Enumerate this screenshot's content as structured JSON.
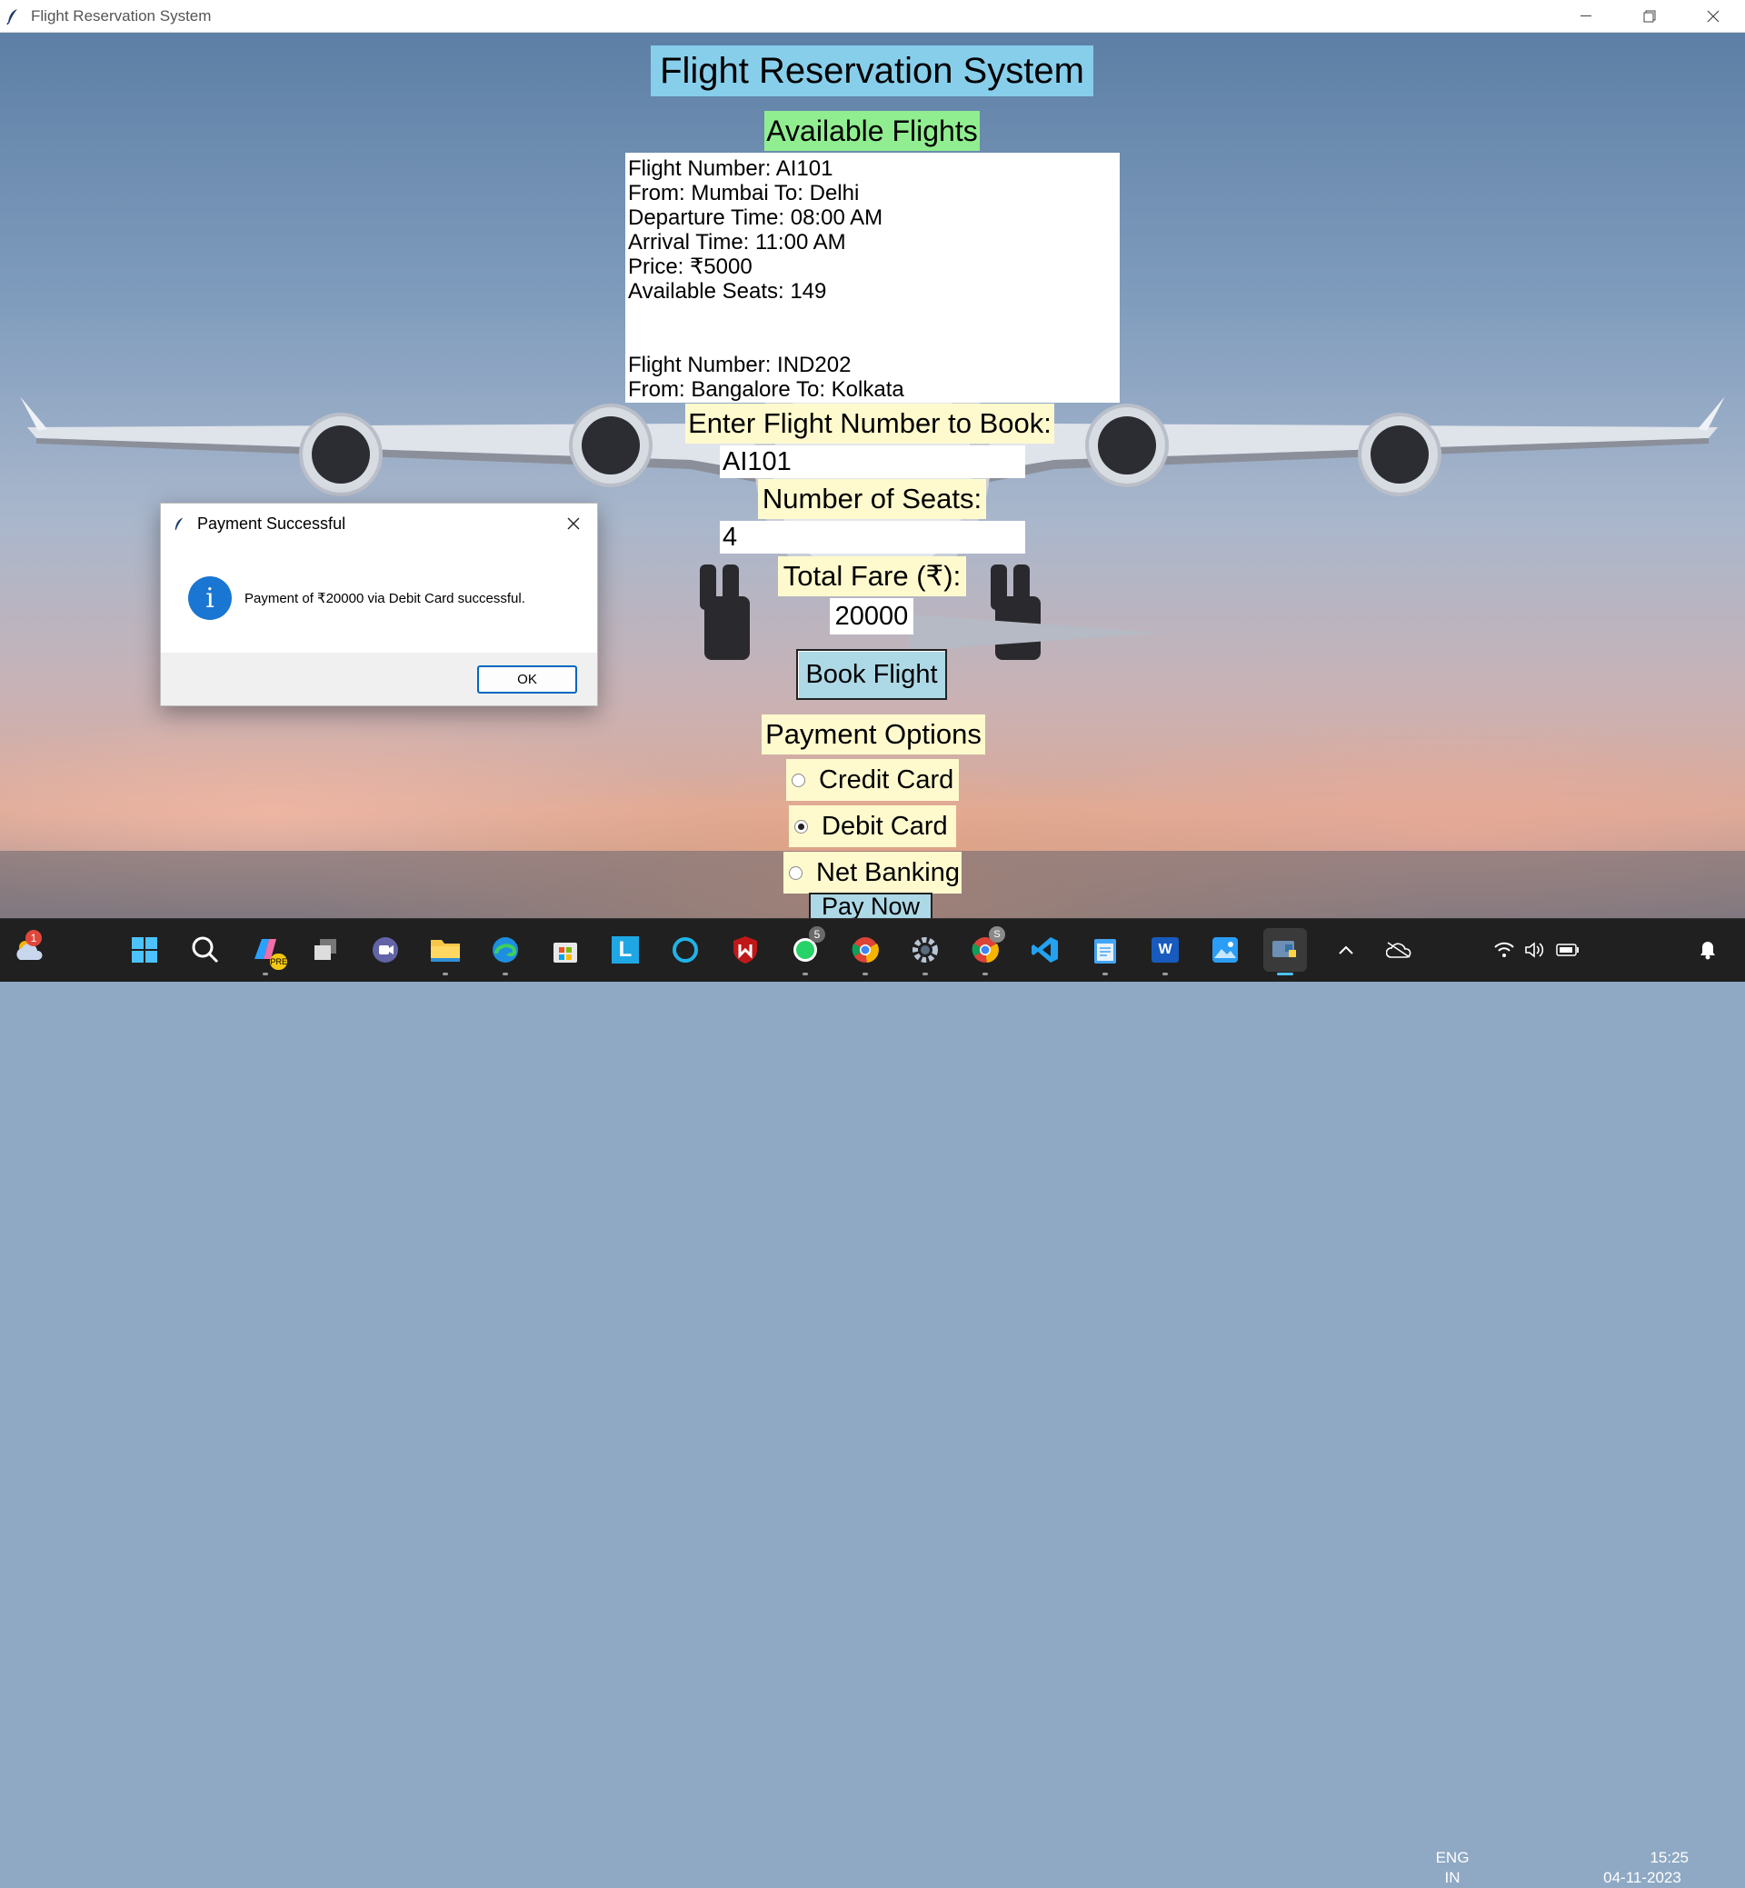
{
  "window": {
    "title": "Flight Reservation System",
    "minimize_icon": "minimize-icon",
    "restore_icon": "restore-icon",
    "close_icon": "close-icon"
  },
  "app": {
    "heading": "Flight Reservation System",
    "available_label": "Available Flights",
    "flights_lines": [
      "Flight Number: AI101",
      "From: Mumbai To: Delhi",
      "Departure Time: 08:00 AM",
      "Arrival Time: 11:00 AM",
      "Price: ₹5000",
      "Available Seats: 149",
      "Flight Number: IND202",
      "From: Bangalore To: Kolkata"
    ],
    "flight_number_label": "Enter Flight Number to Book:",
    "flight_number_value": "AI101",
    "seats_label": "Number of Seats:",
    "seats_value": "4",
    "fare_label": "Total Fare (₹):",
    "fare_value": "20000",
    "book_button": "Book Flight",
    "payment_label": "Payment Options",
    "payment_options": [
      "Credit Card",
      "Debit Card",
      "Net Banking"
    ],
    "payment_selected": "Debit Card",
    "pay_now_button": "Pay Now"
  },
  "dialog": {
    "title": "Payment Successful",
    "message": "Payment of ₹20000 via Debit Card successful.",
    "icon": "info-icon",
    "ok_button": "OK"
  },
  "taskbar": {
    "weather_badge": "1",
    "whatsapp_badge": "5",
    "lang_line1": "ENG",
    "lang_line2": "IN",
    "time": "15:25",
    "date": "04-11-2023",
    "copilot_badge": "PRE",
    "word_letter": "W",
    "launcher_letter": "L",
    "chrome_badge": "S"
  },
  "colors": {
    "heading_bg": "#87ceeb",
    "available_bg": "#90ee90",
    "label_bg": "#fffacd",
    "button_bg": "#add8e6",
    "taskbar_bg": "#202020",
    "accent": "#0067c0"
  }
}
